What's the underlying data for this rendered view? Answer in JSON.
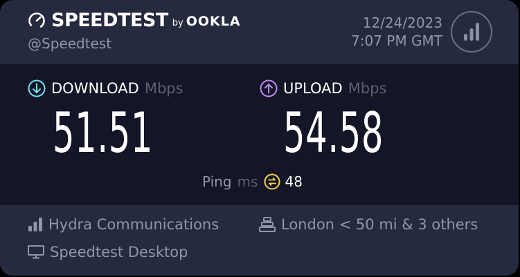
{
  "header": {
    "brand": "SPEEDTEST",
    "brand_by": "by",
    "brand_ookla": "OOKLA",
    "handle": "@Speedtest",
    "date": "12/24/2023",
    "time": "7:07 PM GMT"
  },
  "download": {
    "label": "DOWNLOAD",
    "unit": "Mbps",
    "value": "51.51"
  },
  "upload": {
    "label": "UPLOAD",
    "unit": "Mbps",
    "value": "54.58"
  },
  "ping": {
    "label": "Ping",
    "unit": "ms",
    "value": "48"
  },
  "footer": {
    "isp": "Hydra Communications",
    "server": "London < 50 mi & 3 others",
    "app": "Speedtest Desktop"
  },
  "icons": {
    "logo": "gauge-icon",
    "results": "bars-icon",
    "download": "arrow-down-circle-icon",
    "upload": "arrow-up-circle-icon",
    "ping": "ping-icon",
    "isp": "signal-icon",
    "server": "server-icon",
    "app": "monitor-icon"
  },
  "colors": {
    "card_bg": "#262a3e",
    "metrics_bg": "#141526",
    "download_accent": "#6fe1ef",
    "upload_accent": "#c08bf0",
    "ping_accent": "#f5d550",
    "muted_text": "#9096a9"
  }
}
